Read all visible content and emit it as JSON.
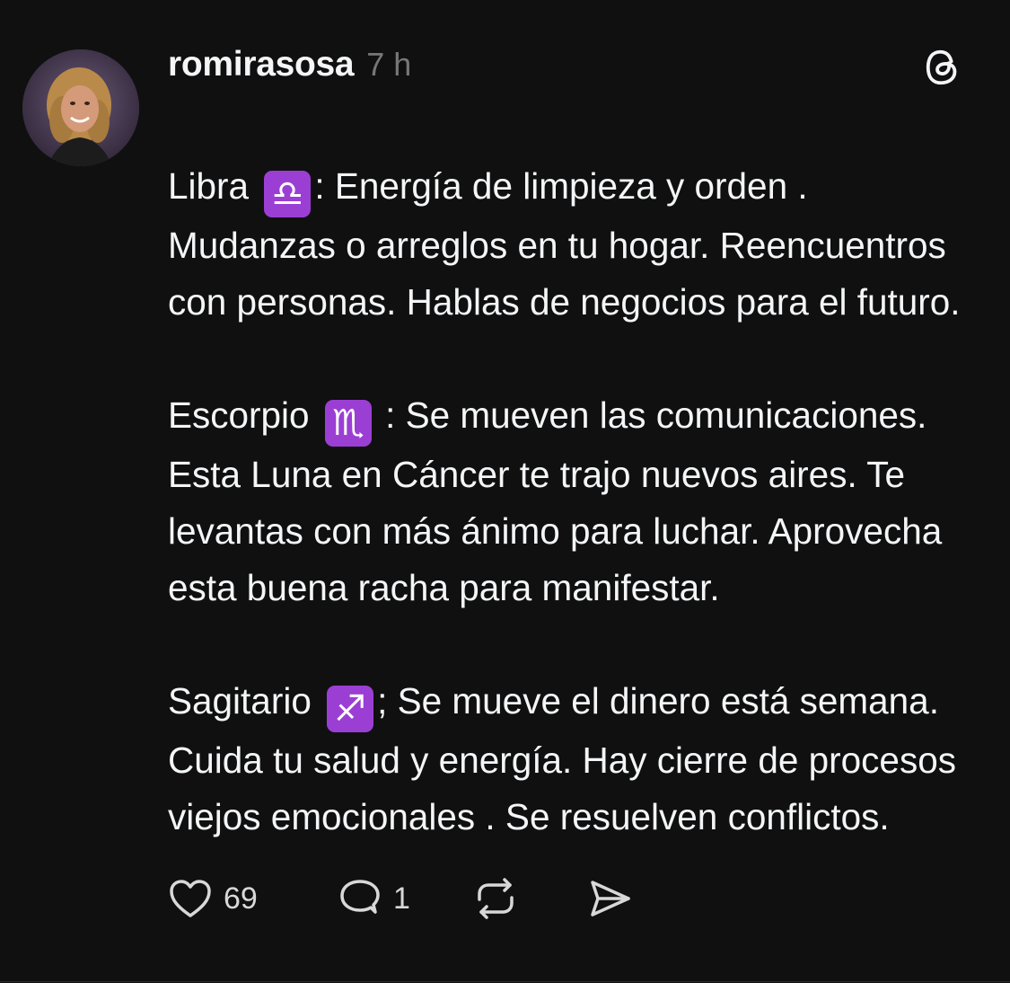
{
  "post": {
    "username": "romirasosa",
    "time": "7 h",
    "paragraphs": [
      {
        "before": "Libra ",
        "sign": "♎",
        "after": ": Energía de limpieza y orden . Mudanzas o arreglos en tu hogar. Reencuentros con personas. Hablas de negocios para el futuro."
      },
      {
        "before": "Escorpio ",
        "sign": "♏",
        "after": " : Se mueven las comunicaciones. Esta Luna en Cáncer te trajo nuevos aires. Te levantas con más ánimo para luchar. Aprovecha esta buena racha para manifestar."
      },
      {
        "before": "Sagitario ",
        "sign": "♐",
        "after": "; Se mueve el dinero está semana. Cuida tu salud y energía. Hay cierre de procesos viejos emocionales . Se resuelven conflictos."
      }
    ],
    "likes": "69",
    "replies": "1"
  },
  "icons": {
    "threads": "threads-logo-icon",
    "like": "heart-icon",
    "reply": "speech-bubble-icon",
    "repost": "repost-arrows-icon",
    "share": "send-icon"
  },
  "colors": {
    "background": "#101010",
    "text": "#f3f5f7",
    "muted": "#777777",
    "zodiac_badge": "#9b3fd4"
  }
}
